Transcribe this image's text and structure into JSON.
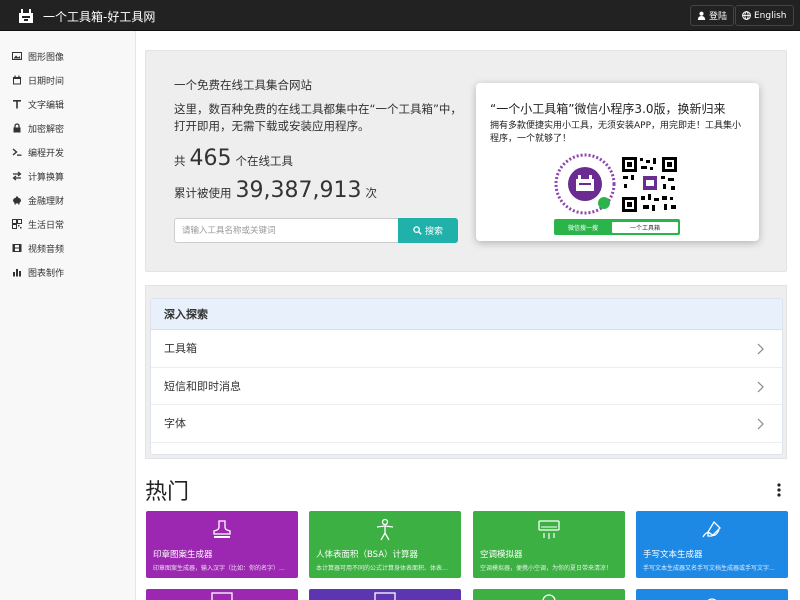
{
  "app": {
    "title": "一个工具箱-好工具网",
    "login_label": "登陆",
    "language_label": "English"
  },
  "sidebar": {
    "items": [
      {
        "label": "图形图像",
        "icon": "image-icon"
      },
      {
        "label": "日期时间",
        "icon": "calendar-icon"
      },
      {
        "label": "文字编辑",
        "icon": "text-icon"
      },
      {
        "label": "加密解密",
        "icon": "lock-icon"
      },
      {
        "label": "编程开发",
        "icon": "terminal-icon"
      },
      {
        "label": "计算换算",
        "icon": "exchange-icon"
      },
      {
        "label": "金融理财",
        "icon": "piggy-bank-icon"
      },
      {
        "label": "生活日常",
        "icon": "qrcode-icon"
      },
      {
        "label": "视频音频",
        "icon": "film-icon"
      },
      {
        "label": "图表制作",
        "icon": "bar-chart-icon"
      }
    ]
  },
  "hero": {
    "title": "一个免费在线工具集合网站",
    "description": "这里，数百种免费的在线工具都集中在“一个工具箱”中，打开即用，无需下载或安装应用程序。",
    "tool_count_prefix": "共",
    "tool_count": "465",
    "tool_count_suffix": "个在线工具",
    "usage_prefix": "累计被使用",
    "usage_count": "39,387,913",
    "usage_suffix": "次",
    "search_placeholder": "请输入工具名称或关键词",
    "search_button": "搜索"
  },
  "promo": {
    "title": "“一个小工具箱”微信小程序3.0版，换新归来",
    "text": "拥有多款便捷实用小工具，无须安装APP，用完即走！工具集小程序，一个就够了！",
    "wechat_label": "微信搜一搜",
    "wechat_name": "一个工具箱"
  },
  "explore": {
    "heading": "深入探索",
    "items": [
      "工具箱",
      "短信和即时消息",
      "字体"
    ]
  },
  "hot": {
    "title": "热门",
    "cards": [
      {
        "title": "印章图案生成器",
        "desc": "印章图案生成器，输入汉字（比如：你的名字）...",
        "color": "#9c27b0",
        "icon": "stamp-icon"
      },
      {
        "title": "人体表面积（BSA）计算器",
        "desc": "本计算器可用不同的公式计算身体表面积、体表...",
        "color": "#3cb043",
        "icon": "person-icon"
      },
      {
        "title": "空调模拟器",
        "desc": "空调模拟器，便携小空调，为你的夏日带来清凉！",
        "color": "#3cb043",
        "icon": "air-conditioner-icon"
      },
      {
        "title": "手写文本生成器",
        "desc": "手写文本生成器又名手写文档生成器或手写文字...",
        "color": "#1e88e5",
        "icon": "handwriting-icon"
      }
    ],
    "second_row_colors": [
      "#9c27b0",
      "#5e35b1",
      "#3cb043",
      "#1e88e5"
    ]
  }
}
